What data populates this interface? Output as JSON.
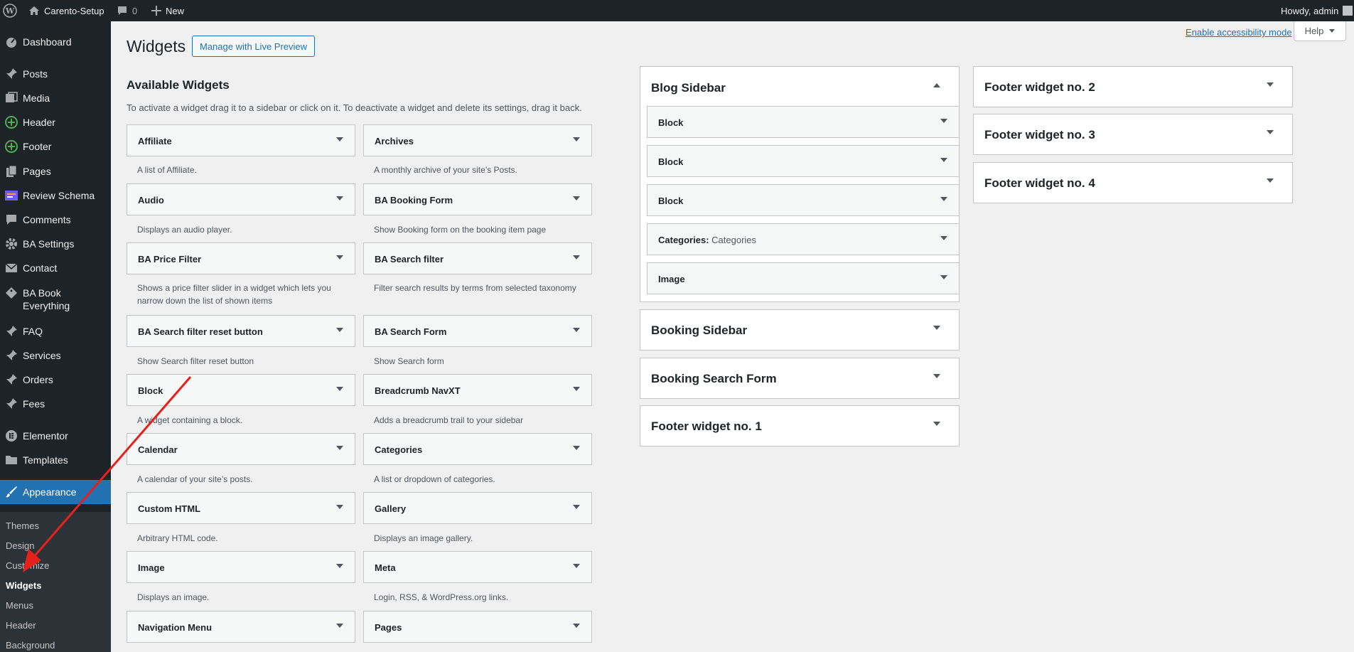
{
  "adminbar": {
    "site_name": "Carento-Setup",
    "comments_count": "0",
    "new_label": "New",
    "howdy": "Howdy, admin"
  },
  "sidebar": {
    "items": [
      {
        "label": "Dashboard",
        "icon": "dashboard-icon"
      },
      {
        "label": "Posts",
        "icon": "pin-icon"
      },
      {
        "label": "Media",
        "icon": "media-icon"
      },
      {
        "label": "Header",
        "icon": "elementor-green-icon"
      },
      {
        "label": "Footer",
        "icon": "elementor-green-icon"
      },
      {
        "label": "Pages",
        "icon": "pages-icon"
      },
      {
        "label": "Review Schema",
        "icon": "review-schema-icon"
      },
      {
        "label": "Comments",
        "icon": "comment-icon"
      },
      {
        "label": "BA Settings",
        "icon": "gear-icon"
      },
      {
        "label": "Contact",
        "icon": "mail-icon"
      },
      {
        "label": "BA Book Everything",
        "icon": "tag-icon"
      },
      {
        "label": "FAQ",
        "icon": "pin-icon"
      },
      {
        "label": "Services",
        "icon": "pin-icon"
      },
      {
        "label": "Orders",
        "icon": "pin-icon"
      },
      {
        "label": "Fees",
        "icon": "pin-icon"
      },
      {
        "label": "Elementor",
        "icon": "elementor-icon"
      },
      {
        "label": "Templates",
        "icon": "folder-icon"
      },
      {
        "label": "Appearance",
        "icon": "brush-icon"
      }
    ],
    "submenu": [
      "Themes",
      "Design",
      "Customize",
      "Widgets",
      "Menus",
      "Header",
      "Background"
    ]
  },
  "header": {
    "title": "Widgets",
    "live_preview": "Manage with Live Preview",
    "a11y": "Enable accessibility mode",
    "help": "Help"
  },
  "available": {
    "title": "Available Widgets",
    "desc": "To activate a widget drag it to a sidebar or click on it. To deactivate a widget and delete its settings, drag it back.",
    "left": [
      {
        "title": "Affiliate",
        "desc": "A list of Affiliate."
      },
      {
        "title": "Audio",
        "desc": "Displays an audio player."
      },
      {
        "title": "BA Price Filter",
        "desc": "Shows a price filter slider in a widget which lets you narrow down the list of shown items"
      },
      {
        "title": "BA Search filter reset button",
        "desc": "Show Search filter reset button"
      },
      {
        "title": "Block",
        "desc": "A widget containing a block."
      },
      {
        "title": "Calendar",
        "desc": "A calendar of your site’s posts."
      },
      {
        "title": "Custom HTML",
        "desc": "Arbitrary HTML code."
      },
      {
        "title": "Image",
        "desc": "Displays an image."
      },
      {
        "title": "Navigation Menu",
        "desc": ""
      }
    ],
    "right": [
      {
        "title": "Archives",
        "desc": "A monthly archive of your site’s Posts."
      },
      {
        "title": "BA Booking Form",
        "desc": "Show Booking form on the booking item page"
      },
      {
        "title": "BA Search filter",
        "desc": "Filter search results by terms from selected taxonomy"
      },
      {
        "title": "BA Search Form",
        "desc": "Show Search form"
      },
      {
        "title": "Breadcrumb NavXT",
        "desc": "Adds a breadcrumb trail to your sidebar"
      },
      {
        "title": "Categories",
        "desc": "A list or dropdown of categories."
      },
      {
        "title": "Gallery",
        "desc": "Displays an image gallery."
      },
      {
        "title": "Meta",
        "desc": "Login, RSS, & WordPress.org links."
      },
      {
        "title": "Pages",
        "desc": ""
      }
    ]
  },
  "areas": {
    "blog_sidebar": {
      "title": "Blog Sidebar",
      "widgets": [
        {
          "title": "Block",
          "sub": ""
        },
        {
          "title": "Block",
          "sub": ""
        },
        {
          "title": "Block",
          "sub": ""
        },
        {
          "title": "Categories:",
          "sub": " Categories"
        },
        {
          "title": "Image",
          "sub": ""
        }
      ]
    },
    "col2": [
      "Booking Sidebar",
      "Booking Search Form",
      "Footer widget no. 1"
    ],
    "col3": [
      "Footer widget no. 2",
      "Footer widget no. 3",
      "Footer widget no. 4"
    ]
  },
  "colors": {
    "accent": "#2271b1",
    "adminbar": "#1d2327",
    "annotation_arrow": "#e8201c"
  }
}
